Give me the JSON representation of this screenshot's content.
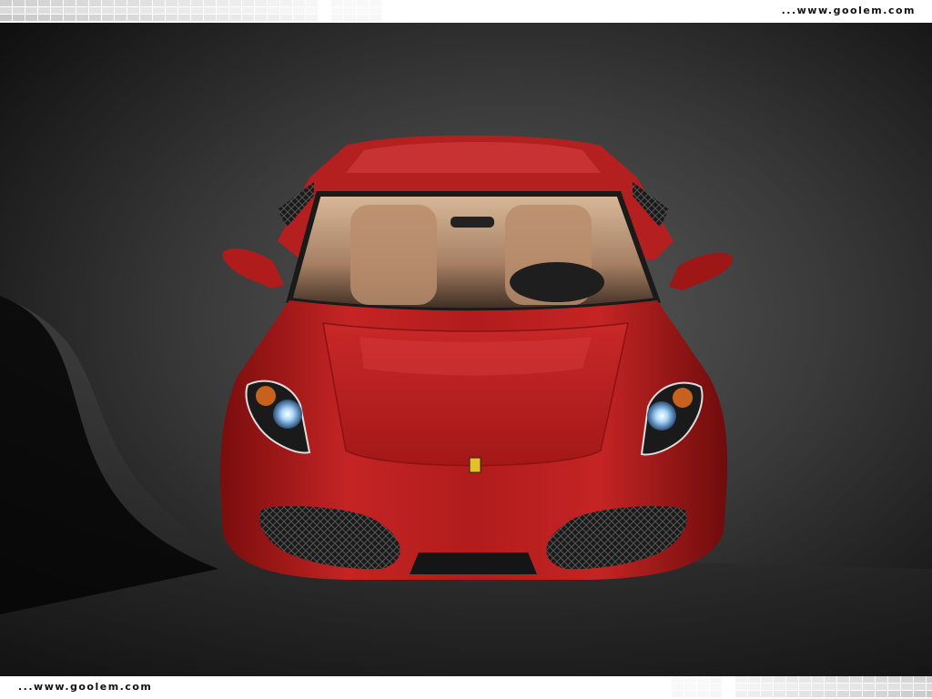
{
  "watermarks": {
    "top": "...www.goolem.com",
    "bottom": "...www.goolem.com"
  },
  "photo": {
    "subject": "car-front-view",
    "colors": {
      "body": "#b81e1e",
      "body_dark": "#6e0c0c",
      "background": "#2a2a2a",
      "interior": "#c49a78"
    }
  }
}
